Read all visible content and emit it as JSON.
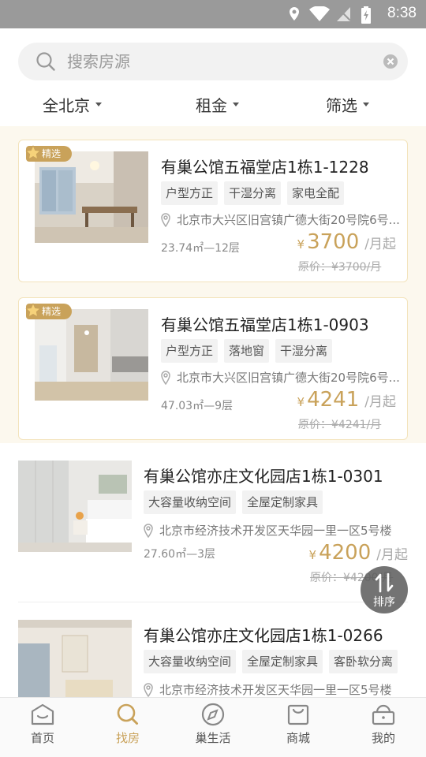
{
  "status": {
    "time": "8:38"
  },
  "search": {
    "placeholder": "搜索房源"
  },
  "filters": [
    {
      "label": "全北京"
    },
    {
      "label": "租金"
    },
    {
      "label": "筛选"
    }
  ],
  "listings": [
    {
      "badge": "精选",
      "title": "有巢公馆五福堂店1栋1-1228",
      "tags": [
        "户型方正",
        "干湿分离",
        "家电全配"
      ],
      "address": "北京市大兴区旧宫镇广德大街20号院6号...",
      "area": "23.74㎡—12层",
      "currency": "¥",
      "price": "3700",
      "unit": "/月起",
      "original": "原价：¥3700/月"
    },
    {
      "badge": "精选",
      "title": "有巢公馆五福堂店1栋1-0903",
      "tags": [
        "户型方正",
        "落地窗",
        "干湿分离"
      ],
      "address": "北京市大兴区旧宫镇广德大街20号院6号...",
      "area": "47.03㎡—9层",
      "currency": "¥",
      "price": "4241",
      "unit": "/月起",
      "original": "原价：¥4241/月"
    },
    {
      "title": "有巢公馆亦庄文化园店1栋1-0301",
      "tags": [
        "大容量收纳空间",
        "全屋定制家具"
      ],
      "address": "北京市经济技术开发区天华园一里一区5号楼",
      "area": "27.60㎡—3层",
      "currency": "¥",
      "price": "4200",
      "unit": "/月起",
      "original": "原价：¥4200/月"
    },
    {
      "title": "有巢公馆亦庄文化园店1栋1-0266",
      "tags": [
        "大容量收纳空间",
        "全屋定制家具",
        "客卧软分离"
      ],
      "address": "北京市经济技术开发区天华园一里一区5号楼"
    }
  ],
  "sort_button": {
    "label": "排序"
  },
  "tabbar": [
    {
      "label": "首页",
      "icon": "home-icon"
    },
    {
      "label": "找房",
      "icon": "search-icon",
      "active": true
    },
    {
      "label": "巢生活",
      "icon": "compass-icon"
    },
    {
      "label": "商城",
      "icon": "shopping-bag-icon"
    },
    {
      "label": "我的",
      "icon": "profile-icon"
    }
  ],
  "colors": {
    "accent": "#c9a25a",
    "featured_bg": "#fcf8ee",
    "status_bar": "#9a9a9a"
  }
}
